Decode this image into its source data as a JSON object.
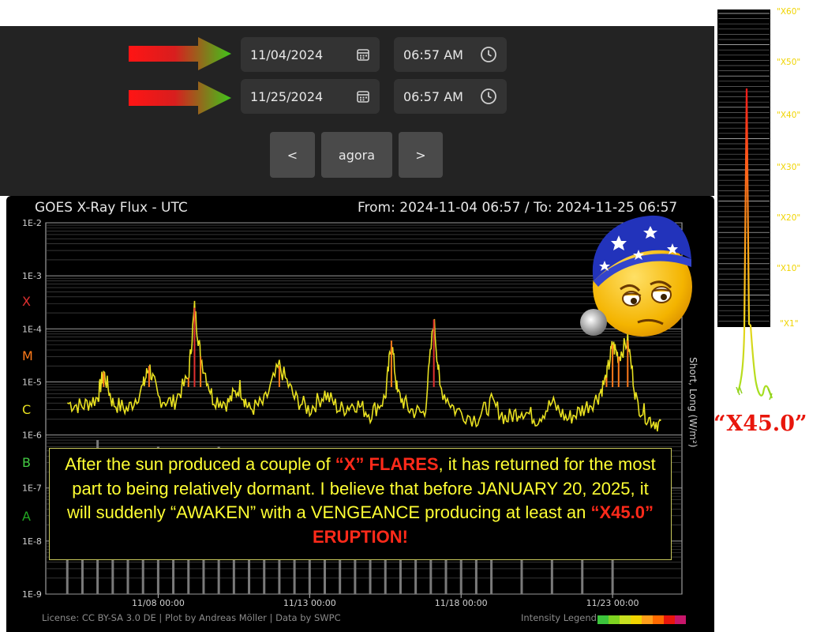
{
  "picker": {
    "start": {
      "date": "11/04/2024",
      "time": "06:57 AM"
    },
    "end": {
      "date": "11/25/2024",
      "time": "06:57 AM"
    },
    "prev_label": "<",
    "now_label": "agora",
    "next_label": ">"
  },
  "chart_header": {
    "title": "GOES X-Ray Flux - UTC",
    "range": "From: 2024-11-04 06:57  /  To: 2024-11-25 06:57"
  },
  "chart_data": {
    "type": "line",
    "title": "GOES X-Ray Flux - UTC",
    "ylabel": "Short, Long (W/m²)",
    "yscale": "log",
    "ylim": [
      1e-09,
      0.01
    ],
    "y_ticks": [
      "1E-2",
      "1E-3",
      "1E-4",
      "1E-5",
      "1E-6",
      "1E-7",
      "1E-8",
      "1E-9"
    ],
    "flare_classes": [
      {
        "label": "X",
        "color": "#e03030"
      },
      {
        "label": "M",
        "color": "#ff7a1a"
      },
      {
        "label": "C",
        "color": "#e8e020"
      },
      {
        "label": "B",
        "color": "#44cc44"
      },
      {
        "label": "A",
        "color": "#22a822"
      }
    ],
    "x_ticks": [
      "11/08 00:00",
      "11/13 00:00",
      "11/18 00:00",
      "11/23 00:00"
    ],
    "xlim_days": [
      -0.71,
      20.29
    ],
    "series": [
      {
        "name": "Long",
        "color": "#e8e020",
        "points": [
          [
            0.0,
            4e-06
          ],
          [
            0.5,
            3.5e-06
          ],
          [
            1.0,
            5e-06
          ],
          [
            1.2,
            1.5e-05
          ],
          [
            1.5,
            4e-06
          ],
          [
            2.0,
            3e-06
          ],
          [
            2.5,
            8e-06
          ],
          [
            2.7,
            2e-05
          ],
          [
            3.0,
            5e-06
          ],
          [
            3.5,
            4e-06
          ],
          [
            4.0,
            1.2e-05
          ],
          [
            4.2,
            0.00025
          ],
          [
            4.4,
            3e-05
          ],
          [
            4.8,
            5e-06
          ],
          [
            5.3,
            4e-06
          ],
          [
            5.7,
            8e-06
          ],
          [
            6.0,
            3e-06
          ],
          [
            6.5,
            4e-06
          ],
          [
            7.0,
            2e-05
          ],
          [
            7.5,
            5e-06
          ],
          [
            8.0,
            3e-06
          ],
          [
            8.5,
            6e-06
          ],
          [
            9.0,
            3e-06
          ],
          [
            9.5,
            4e-06
          ],
          [
            10.0,
            2.5e-06
          ],
          [
            10.5,
            5e-06
          ],
          [
            10.7,
            6e-05
          ],
          [
            10.9,
            6e-06
          ],
          [
            11.3,
            3e-06
          ],
          [
            11.8,
            2.5e-06
          ],
          [
            12.1,
            0.00015
          ],
          [
            12.3,
            8e-06
          ],
          [
            12.8,
            3e-06
          ],
          [
            13.5,
            2e-06
          ],
          [
            14.0,
            4e-06
          ],
          [
            14.5,
            2e-06
          ],
          [
            15.0,
            3e-06
          ],
          [
            15.5,
            2e-06
          ],
          [
            16.0,
            4e-06
          ],
          [
            16.5,
            2e-06
          ],
          [
            17.0,
            3e-06
          ],
          [
            17.5,
            5e-06
          ],
          [
            17.8,
            1.2e-05
          ],
          [
            18.0,
            5e-05
          ],
          [
            18.2,
            3e-05
          ],
          [
            18.5,
            6e-05
          ],
          [
            18.8,
            4e-06
          ],
          [
            19.2,
            2e-06
          ],
          [
            19.6,
            1.6e-06
          ]
        ]
      },
      {
        "name": "Short",
        "color": "#7a7a7a",
        "points": [
          [
            0.0,
            4e-07
          ],
          [
            0.5,
            3e-07
          ],
          [
            1.0,
            8e-07
          ],
          [
            1.5,
            2e-07
          ],
          [
            2.0,
            4e-07
          ],
          [
            2.5,
            3e-07
          ],
          [
            3.0,
            6e-07
          ],
          [
            3.5,
            1.5e-07
          ],
          [
            4.0,
            5e-07
          ],
          [
            4.5,
            3e-07
          ],
          [
            5.0,
            6e-07
          ],
          [
            5.5,
            2e-07
          ],
          [
            6.0,
            4e-07
          ],
          [
            6.5,
            3e-07
          ],
          [
            7.0,
            5e-07
          ],
          [
            7.5,
            2e-07
          ],
          [
            8.0,
            4e-07
          ],
          [
            8.5,
            2.5e-07
          ],
          [
            9.0,
            4e-07
          ],
          [
            9.5,
            3e-07
          ],
          [
            10.0,
            5e-07
          ],
          [
            10.5,
            3e-07
          ],
          [
            11.0,
            1e-08
          ],
          [
            11.5,
            3e-07
          ],
          [
            12.0,
            4e-07
          ],
          [
            12.5,
            3e-07
          ],
          [
            13.0,
            2e-07
          ],
          [
            13.5,
            3e-07
          ],
          [
            14.0,
            4e-07
          ],
          [
            15.0,
            3e-07
          ],
          [
            16.0,
            4e-07
          ],
          [
            17.0,
            3e-07
          ],
          [
            18.0,
            5e-07
          ]
        ]
      }
    ]
  },
  "annotation": {
    "l1a": "After the sun produced a couple of ",
    "l1b": "“X” FLARES",
    "l1c": ", it has returned for the most part to being relatively dormant. I believe that before JANUARY 20, 2025, it will suddenly “AWAKEN” with a VENGEANCE producing at least an ",
    "l1d": "“X45.0” ERUPTION!"
  },
  "footer": {
    "license": "License: CC BY-SA 3.0 DE | Plot by Andreas Möller | Data by SWPC",
    "legend": "Intensity Legend",
    "legend_colors": [
      "#3cc43c",
      "#7ed321",
      "#c8e020",
      "#f0d400",
      "#ff9f1a",
      "#ff6a00",
      "#e8160c",
      "#c7166a"
    ]
  },
  "side_chart": {
    "labels": [
      "\"X60\"",
      "\"X50\"",
      "\"X40\"",
      "\"X30\"",
      "\"X20\"",
      "\"X10\"",
      "\"X1\""
    ],
    "headline": "“X45.0”"
  }
}
